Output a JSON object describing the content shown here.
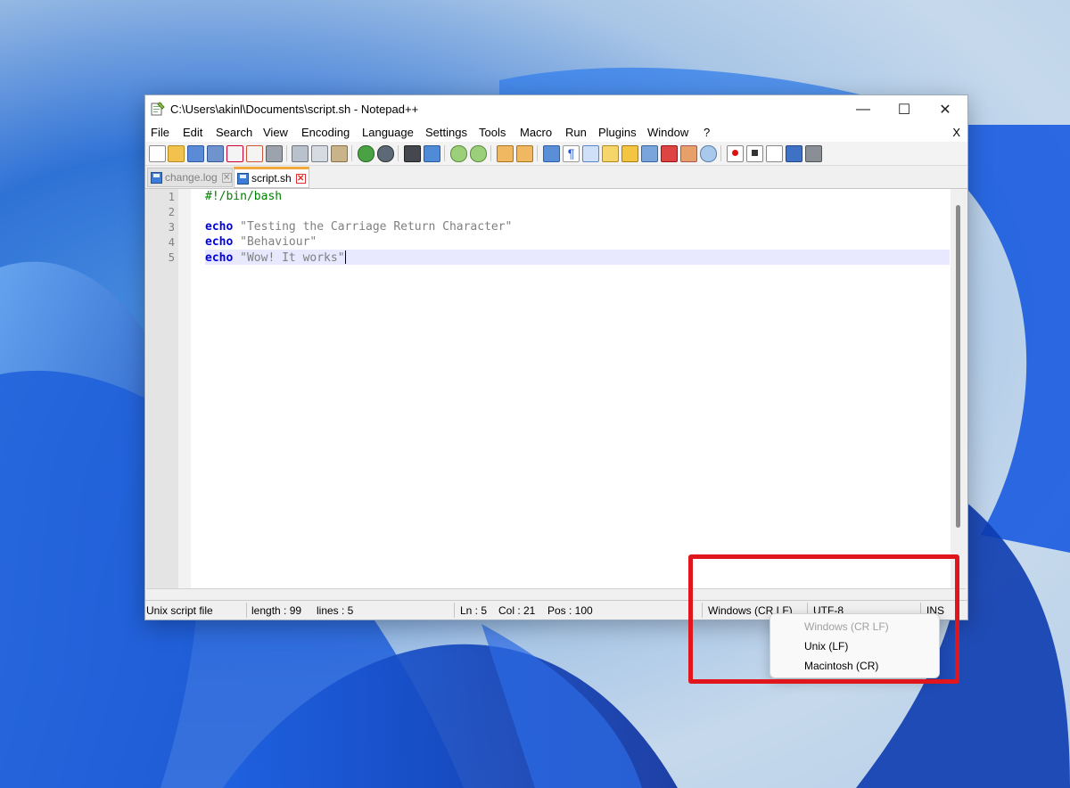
{
  "window": {
    "title": "C:\\Users\\akinl\\Documents\\script.sh - Notepad++",
    "minimize_glyph": "—",
    "maximize_glyph": "☐",
    "close_glyph": "✕"
  },
  "menu": {
    "items": [
      "File",
      "Edit",
      "Search",
      "View",
      "Encoding",
      "Language",
      "Settings",
      "Tools",
      "Macro",
      "Run",
      "Plugins",
      "Window",
      "?"
    ],
    "close_label": "X"
  },
  "tabs": [
    {
      "label": "change.log",
      "active": false
    },
    {
      "label": "script.sh",
      "active": true
    }
  ],
  "tab_close_glyph": "✕",
  "editor": {
    "line_numbers": [
      "1",
      "2",
      "3",
      "4",
      "5"
    ],
    "lines": [
      {
        "comment": "#!/bin/bash"
      },
      {},
      {
        "keyword": "echo",
        "string": "\"Testing the Carriage Return Character\""
      },
      {
        "keyword": "echo",
        "string": "\"Behaviour\""
      },
      {
        "keyword": "echo",
        "string": "\"Wow! It works\""
      }
    ]
  },
  "status": {
    "file_type": "Unix script file",
    "length": "length : 99",
    "lines": "lines : 5",
    "ln": "Ln : 5",
    "col": "Col : 21",
    "pos": "Pos : 100",
    "eol": "Windows (CR LF)",
    "encoding": "UTF-8",
    "mode": "INS"
  },
  "eol_menu": {
    "options": [
      "Windows (CR LF)",
      "Unix (LF)",
      "Macintosh (CR)"
    ],
    "disabled_index": 0
  },
  "colors": {
    "highlight_box": "#e0161c",
    "keyword": "#0000e0",
    "active_tab_accent": "#f3a93a"
  }
}
